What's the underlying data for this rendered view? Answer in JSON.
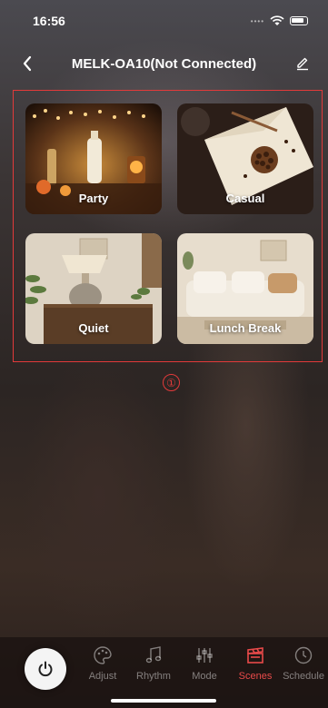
{
  "status_bar": {
    "time": "16:56"
  },
  "nav": {
    "title": "MELK-OA10(Not Connected)"
  },
  "scenes": [
    {
      "label": "Party"
    },
    {
      "label": "Casual"
    },
    {
      "label": "Quiet"
    },
    {
      "label": "Lunch Break"
    }
  ],
  "annotation_marker": "①",
  "tabs": [
    {
      "label": "Adjust",
      "icon": "palette-icon"
    },
    {
      "label": "Rhythm",
      "icon": "music-note-icon"
    },
    {
      "label": "Mode",
      "icon": "sliders-icon"
    },
    {
      "label": "Scenes",
      "icon": "clapperboard-icon",
      "active": true
    },
    {
      "label": "Schedule",
      "icon": "clock-icon"
    }
  ],
  "colors": {
    "accent": "#e84a4a",
    "highlight_box": "#e23a3a"
  }
}
